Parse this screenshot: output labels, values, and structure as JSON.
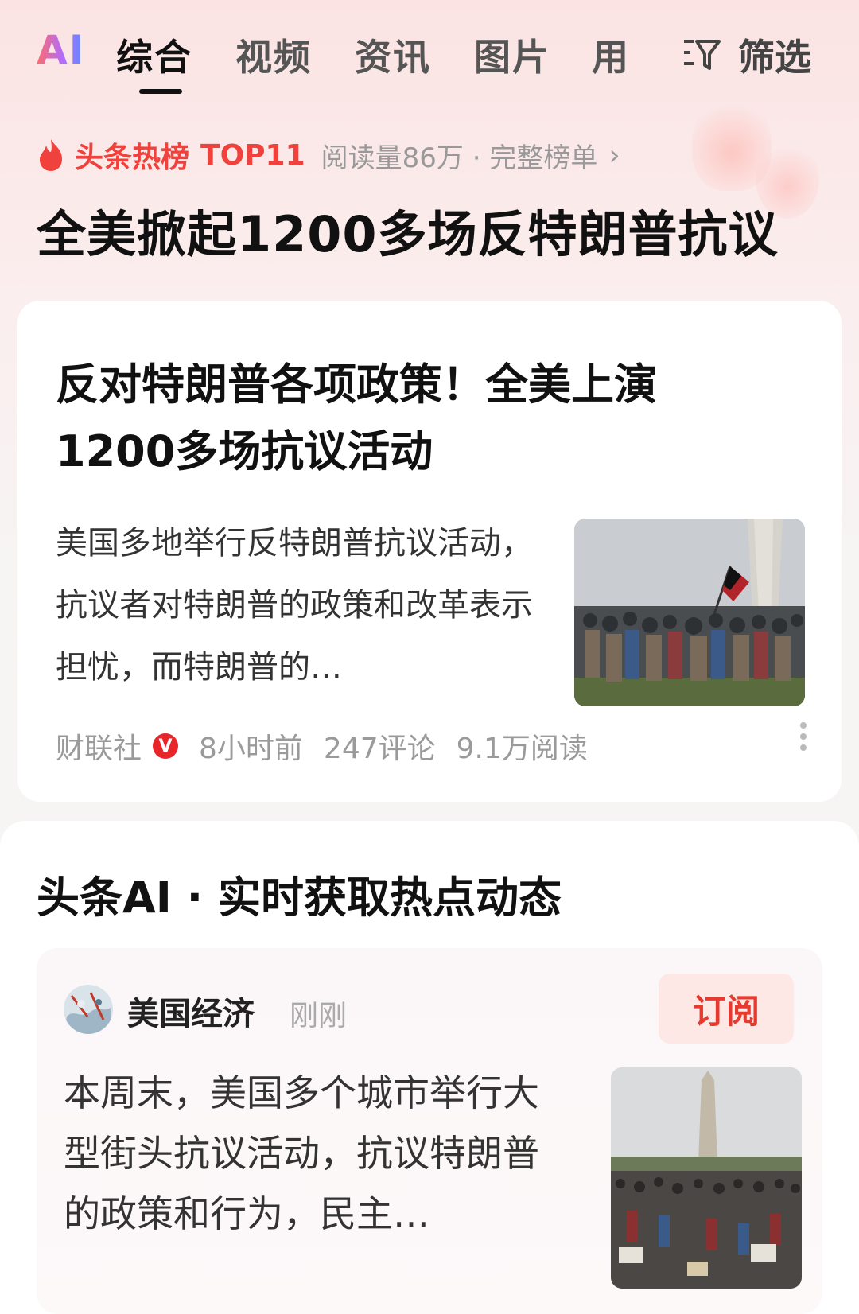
{
  "tabs": {
    "ai": "AI",
    "items": [
      "综合",
      "视频",
      "资讯",
      "图片",
      "用"
    ],
    "filter_label": "筛选"
  },
  "hot": {
    "title": "头条热榜",
    "rank": "TOP11",
    "meta": "阅读量86万 · 完整榜单",
    "chevron": "›"
  },
  "headline": "全美掀起1200多场反特朗普抗议",
  "card1": {
    "title": "反对特朗普各项政策！全美上演1200多场抗议活动",
    "summary": "美国多地举行反特朗普抗议活动，抗议者对特朗普的政策和改革表示担忧，而特朗普的…",
    "source": "财联社",
    "verified_badge": "V",
    "time": "8小时前",
    "comments": "247评论",
    "reads": "9.1万阅读"
  },
  "card2": {
    "title": "头条AI · 实时获取热点动态",
    "account": "美国经济",
    "time": "刚刚",
    "subscribe": "订阅",
    "summary": "本周末，美国多个城市举行大型街头抗议活动，抗议特朗普的政策和行为，民主…"
  },
  "colors": {
    "accent_red": "#f0413c",
    "subscribe_bg": "#fde8e6"
  }
}
